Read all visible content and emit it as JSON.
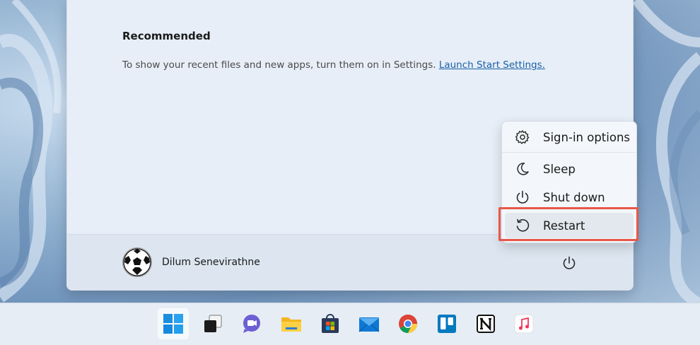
{
  "start_menu": {
    "recommended_title": "Recommended",
    "recommended_text": "To show your recent files and new apps, turn them on in Settings.",
    "recommended_link": "Launch Start Settings.",
    "user_name": "Dilum Senevirathne"
  },
  "power_menu": {
    "items": [
      {
        "label": "Sign-in options",
        "icon": "gear-icon"
      },
      {
        "label": "Sleep",
        "icon": "moon-icon"
      },
      {
        "label": "Shut down",
        "icon": "power-icon"
      },
      {
        "label": "Restart",
        "icon": "restart-icon"
      }
    ],
    "highlight_color": "#e8574a"
  },
  "taskbar": {
    "icons": [
      "windows-start-icon",
      "task-view-icon",
      "chat-icon",
      "file-explorer-icon",
      "microsoft-store-icon",
      "mail-icon",
      "chrome-icon",
      "trello-icon",
      "notion-icon",
      "itunes-icon"
    ]
  }
}
